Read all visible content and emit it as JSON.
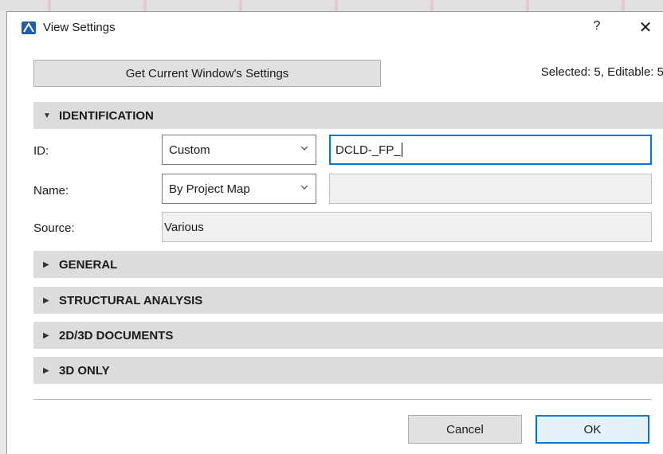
{
  "window": {
    "title": "View Settings",
    "help_label": "?",
    "close_label": "✕"
  },
  "toolbar": {
    "get_settings_label": "Get Current Window's Settings",
    "status_text": "Selected: 5, Editable: 5"
  },
  "sections": {
    "identification": "IDENTIFICATION",
    "general": "GENERAL",
    "structural": "STRUCTURAL ANALYSIS",
    "documents": "2D/3D DOCUMENTS",
    "only3d": "3D ONLY"
  },
  "identification": {
    "id_label": "ID:",
    "id_mode": "Custom",
    "id_value": "DCLD-_FP_",
    "name_label": "Name:",
    "name_mode": "By Project Map",
    "name_value": "",
    "source_label": "Source:",
    "source_value": "Various"
  },
  "footer": {
    "cancel_label": "Cancel",
    "ok_label": "OK"
  },
  "colors": {
    "accent": "#0078d7",
    "section_bg": "#dcdcdc"
  }
}
